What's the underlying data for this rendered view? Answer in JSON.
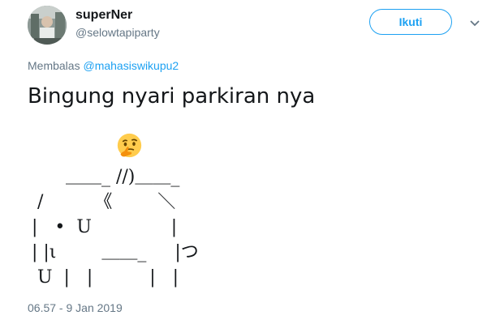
{
  "tweet": {
    "display_name": "superNer",
    "handle": "@selowtapiparty",
    "follow_label": "Ikuti",
    "reply_prefix": "Membalas",
    "reply_mention": "@mahasiswikupu2",
    "text": "Bingung nyari parkiran nya",
    "ascii_art": "       ＿＿_ //)＿＿_\n  /         《        ＼\n |   •  U              |\n | |ι        ＿＿_     |つ\n  U  |   |          |   |",
    "timestamp": "06.57 - 9 Jan 2019"
  },
  "icons": {
    "avatar": "user-avatar",
    "chevron": "chevron-down-icon",
    "emoji": "thinking-face-emoji"
  },
  "colors": {
    "accent": "#1da1f2",
    "secondary_text": "#657786",
    "primary_text": "#14171a"
  }
}
